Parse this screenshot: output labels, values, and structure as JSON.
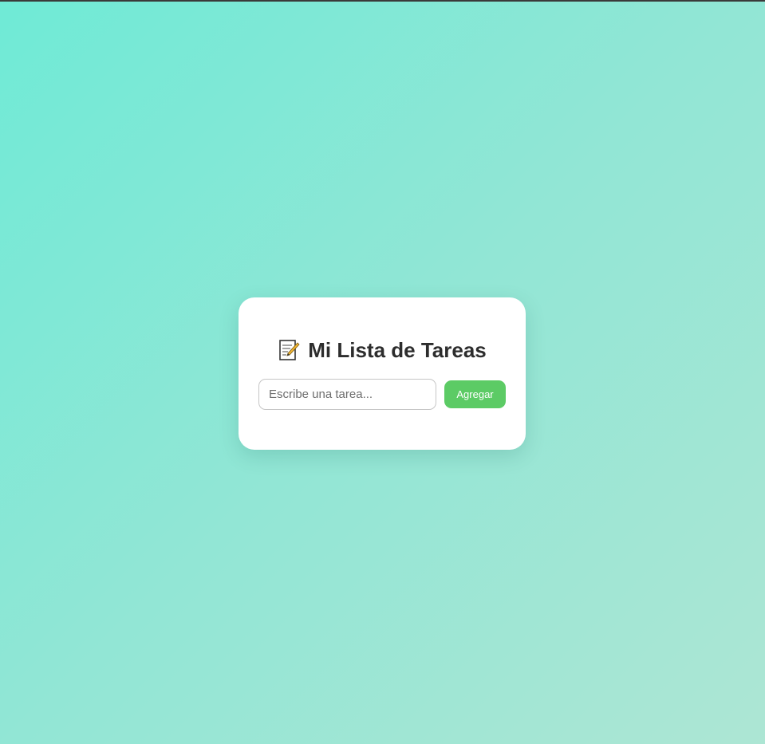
{
  "app": {
    "title": "Mi Lista de Tareas",
    "title_icon": "memo-pencil-icon"
  },
  "form": {
    "input_value": "",
    "input_placeholder": "Escribe una tarea...",
    "add_button_label": "Agregar"
  },
  "tasks": [],
  "colors": {
    "background_start": "#6fead6",
    "background_end": "#ade6d4",
    "card": "#ffffff",
    "accent_button": "#5ccb65",
    "title_text": "#2d2d2d"
  }
}
